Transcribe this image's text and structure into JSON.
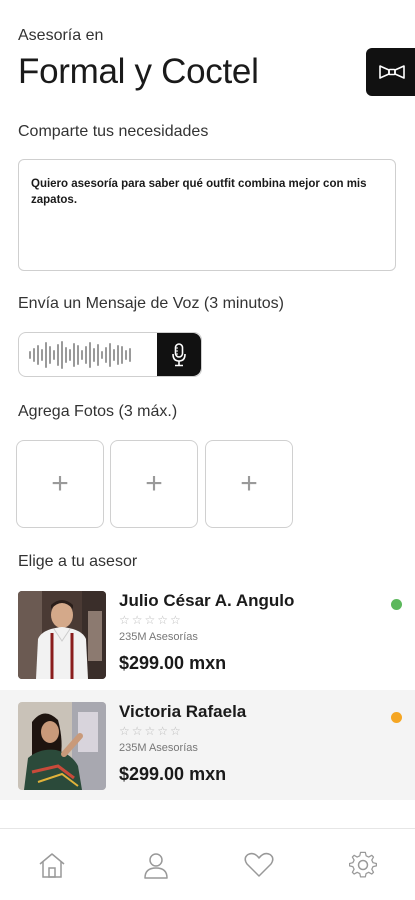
{
  "header": {
    "subtitle": "Asesoría en",
    "title": "Formal y Coctel"
  },
  "needs": {
    "label": "Comparte tus necesidades",
    "value": "Quiero asesoría para saber qué outfit combina mejor con mis zapatos."
  },
  "voice": {
    "label": "Envía un Mensaje de Voz (3 minutos)"
  },
  "photos": {
    "label": "Agrega Fotos (3 máx.)",
    "slots": [
      "+",
      "+",
      "+"
    ]
  },
  "advisors": {
    "label": "Elige a tu asesor",
    "items": [
      {
        "name": "Julio César A. Angulo",
        "stars": "☆☆☆☆☆",
        "count": "235M Asesorías",
        "price": "$299.00 mxn",
        "status_color": "#5cb85c"
      },
      {
        "name": "Victoria Rafaela",
        "stars": "☆☆☆☆☆",
        "count": "235M Asesorías",
        "price": "$299.00 mxn",
        "status_color": "#f5a623"
      }
    ]
  },
  "nav": {
    "icons": [
      "home-icon",
      "profile-icon",
      "heart-icon",
      "gear-icon"
    ]
  }
}
